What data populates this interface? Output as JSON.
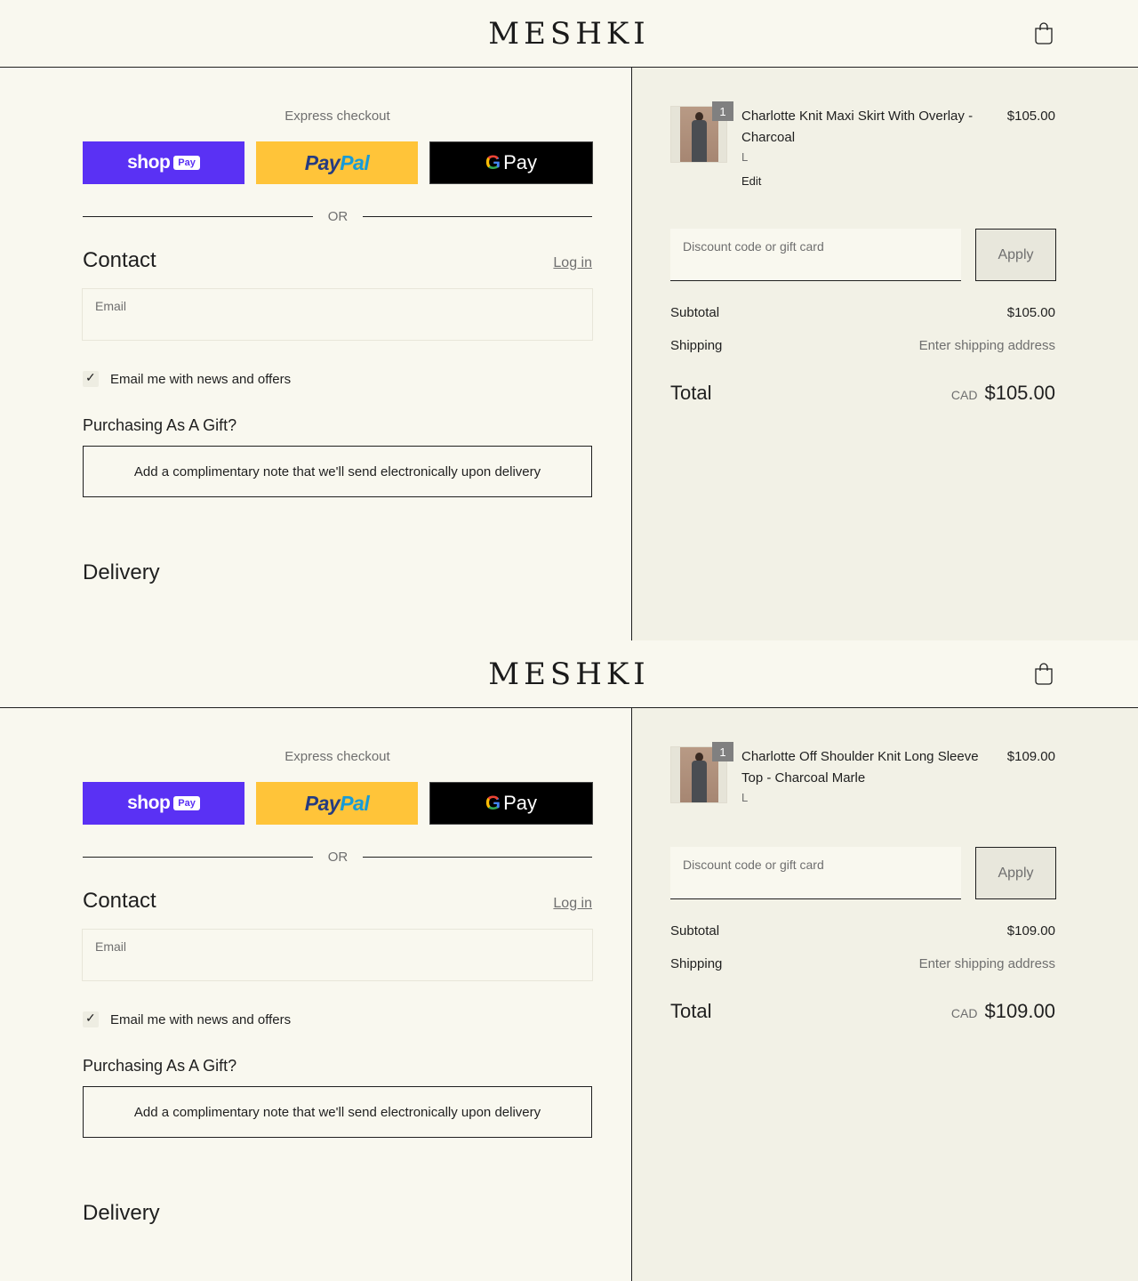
{
  "screens": [
    {
      "brand": "MESHKI",
      "express_label": "Express checkout",
      "or_label": "OR",
      "shop_word": "shop",
      "shop_pay": "Pay",
      "paypal_pay": "Pay",
      "paypal_pal": "Pal",
      "gpay_g": "G",
      "gpay_word": "Pay",
      "contact_title": "Contact",
      "login_label": "Log in",
      "email_placeholder": "Email",
      "news_checked": true,
      "news_label": "Email me with news and offers",
      "gift_title": "Purchasing As A Gift?",
      "gift_button": "Add a complimentary note that we'll send electronically upon delivery",
      "delivery_title": "Delivery",
      "item": {
        "name": "Charlotte Knit Maxi Skirt With Overlay - Charcoal",
        "size": "L",
        "edit": "Edit",
        "price": "$105.00",
        "quantity": "1"
      },
      "discount_placeholder": "Discount code or gift card",
      "apply_label": "Apply",
      "subtotal_label": "Subtotal",
      "subtotal_value": "$105.00",
      "shipping_label": "Shipping",
      "shipping_value": "Enter shipping address",
      "total_label": "Total",
      "total_currency": "CAD",
      "total_value": "$105.00"
    },
    {
      "brand": "MESHKI",
      "express_label": "Express checkout",
      "or_label": "OR",
      "shop_word": "shop",
      "shop_pay": "Pay",
      "paypal_pay": "Pay",
      "paypal_pal": "Pal",
      "gpay_g": "G",
      "gpay_word": "Pay",
      "contact_title": "Contact",
      "login_label": "Log in",
      "email_placeholder": "Email",
      "news_checked": true,
      "news_label": "Email me with news and offers",
      "gift_title": "Purchasing As A Gift?",
      "gift_button": "Add a complimentary note that we'll send electronically upon delivery",
      "delivery_title": "Delivery",
      "item": {
        "name": "Charlotte Off Shoulder Knit Long Sleeve Top - Charcoal Marle",
        "size": "L",
        "edit": "",
        "price": "$109.00",
        "quantity": "1"
      },
      "discount_placeholder": "Discount code or gift card",
      "apply_label": "Apply",
      "subtotal_label": "Subtotal",
      "subtotal_value": "$109.00",
      "shipping_label": "Shipping",
      "shipping_value": "Enter shipping address",
      "total_label": "Total",
      "total_currency": "CAD",
      "total_value": "$109.00"
    }
  ],
  "colors": {
    "background": "#f9f8ef",
    "summary_background": "#f2f1e6",
    "shop_pay": "#5a31f4",
    "paypal": "#ffc439",
    "gpay": "#000000"
  },
  "icons": {
    "cart": "shopping-bag-icon",
    "check": "checkmark-icon"
  }
}
